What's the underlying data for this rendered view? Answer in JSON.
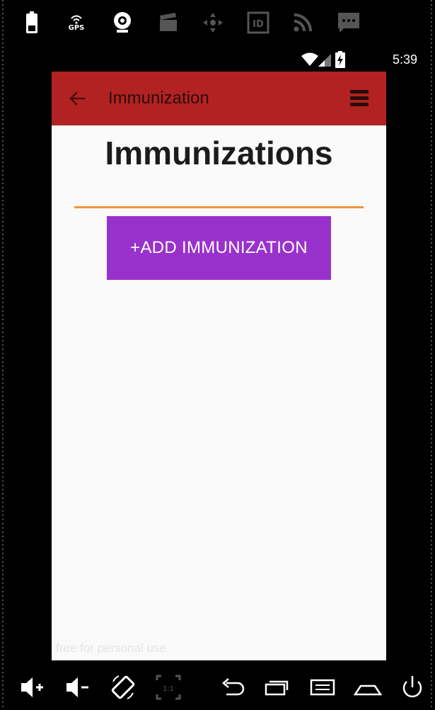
{
  "emulator_toolbar": {
    "icons": [
      "battery-icon",
      "gps-icon",
      "webcam-icon",
      "clapperboard-icon",
      "dpad-icon",
      "id-icon",
      "rss-icon",
      "sms-icon"
    ],
    "gps_label": "GPS",
    "id_label": "ID"
  },
  "status_bar": {
    "time": "5:39"
  },
  "app_bar": {
    "title": "Immunization",
    "color": "#b22222"
  },
  "main": {
    "heading": "Immunizations",
    "add_button_label": "+ADD IMMUNIZATION",
    "add_button_color": "#9932cc",
    "divider_color": "#f0943a"
  },
  "watermark": "free for personal use",
  "emulator_bottom": {
    "icons": [
      "volume-up-icon",
      "volume-down-icon",
      "rotate-icon",
      "scale-icon",
      "back-icon",
      "recent-apps-icon",
      "menu-icon",
      "home-icon",
      "power-icon"
    ],
    "scale_label": "1:1"
  }
}
